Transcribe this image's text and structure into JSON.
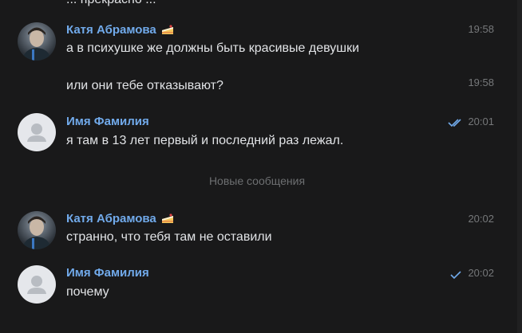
{
  "chat": {
    "cut_off_text": "... прекрасно ...",
    "divider_label": "Новые сообщения",
    "messages": [
      {
        "sender": "Катя Абрамова",
        "text": "а в психушке же должны быть красивые девушки",
        "time": "19:58",
        "badge": "cake-icon"
      },
      {
        "text": "или они тебе отказывают?",
        "time": "19:58"
      },
      {
        "sender": "Имя Фамилия",
        "text": "я там в 13 лет первый и последний раз лежал.",
        "time": "20:01",
        "status": "double-check-icon"
      },
      {
        "sender": "Катя Абрамова",
        "text": "странно, что тебя там не оставили",
        "time": "20:02",
        "badge": "cake-icon"
      },
      {
        "sender": "Имя Фамилия",
        "text": "почему",
        "time": "20:02",
        "status": "check-icon"
      }
    ]
  },
  "colors": {
    "background": "#19191a",
    "sender_name": "#71aaeb",
    "message_text": "#e1e3e6",
    "time_text": "#76787a",
    "divider_text": "#6d6f71",
    "read_check": "#71aaeb",
    "avatar_placeholder": "#e5e7eb"
  }
}
